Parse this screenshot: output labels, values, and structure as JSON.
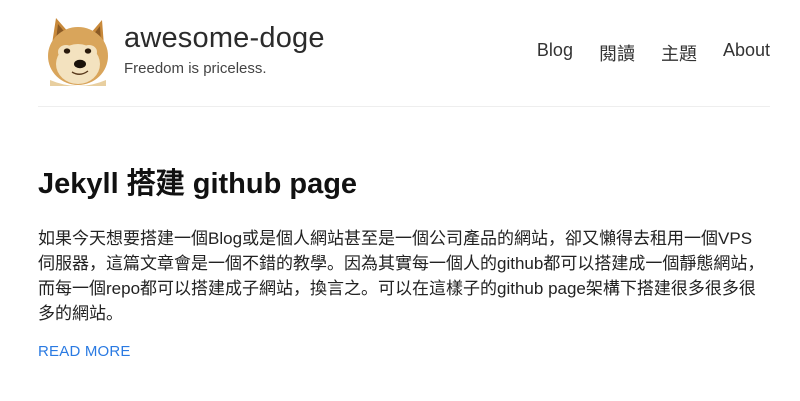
{
  "site": {
    "title": "awesome-doge",
    "tagline": "Freedom is priceless."
  },
  "nav": {
    "items": [
      {
        "label": "Blog"
      },
      {
        "label": "閱讀"
      },
      {
        "label": "主題"
      },
      {
        "label": "About"
      }
    ]
  },
  "post": {
    "title": "Jekyll 搭建 github page",
    "excerpt": "如果今天想要搭建一個Blog或是個人網站甚至是一個公司產品的網站，卻又懶得去租用一個VPS伺服器，這篇文章會是一個不錯的教學。因為其實每一個人的github都可以搭建成一個靜態網站，而每一個repo都可以搭建成子網站，換言之。可以在這樣子的github page架構下搭建很多很多很多的網站。",
    "read_more": "READ MORE"
  },
  "colors": {
    "link": "#2a7ae2",
    "text": "#222222",
    "divider": "#eeeeee"
  },
  "icons": {
    "logo": "doge-logo"
  }
}
